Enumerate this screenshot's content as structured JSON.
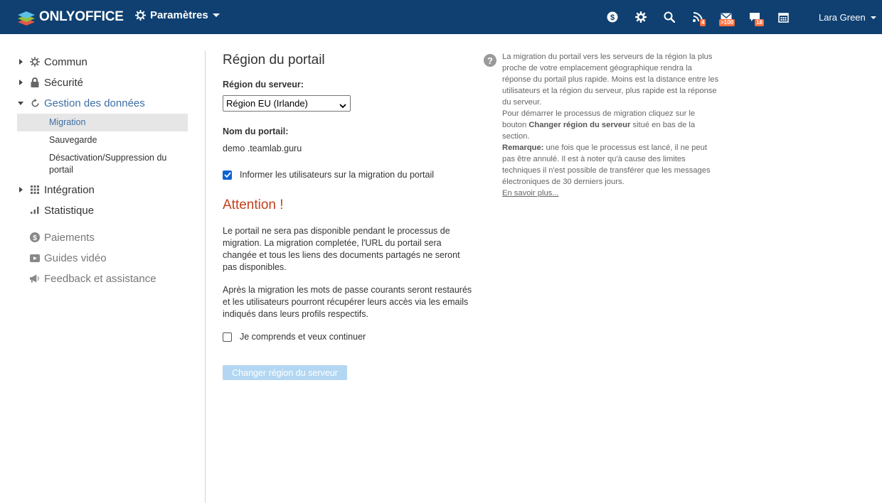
{
  "header": {
    "logo_text": "ONLYOFFICE",
    "settings_label": "Paramètres",
    "icons": [
      {
        "name": "payments-icon",
        "badge": ""
      },
      {
        "name": "gear-icon",
        "badge": ""
      },
      {
        "name": "search-icon",
        "badge": ""
      },
      {
        "name": "feed-icon",
        "badge": "4"
      },
      {
        "name": "mail-icon",
        "badge": ">100"
      },
      {
        "name": "chat-icon",
        "badge": "18"
      },
      {
        "name": "calendar-icon",
        "badge": ""
      }
    ],
    "user_name": "Lara Green",
    "colors": {
      "header_bg": "#0f4071",
      "badge": "#ff6f3d"
    }
  },
  "sidebar": {
    "items": [
      {
        "label": "Commun",
        "icon": "gear-icon"
      },
      {
        "label": "Sécurité",
        "icon": "lock-icon"
      },
      {
        "label": "Gestion des données",
        "icon": "refresh-icon"
      },
      {
        "label": "Intégration",
        "icon": "grid-icon"
      },
      {
        "label": "Statistique",
        "icon": "bar-chart-icon"
      }
    ],
    "sub_items": [
      "Migration",
      "Sauvegarde",
      "Désactivation/Suppression du portail"
    ],
    "extra_items": [
      {
        "label": "Paiements",
        "icon": "dollar-icon"
      },
      {
        "label": "Guides vidéo",
        "icon": "video-icon"
      },
      {
        "label": "Feedback et assistance",
        "icon": "megaphone-icon"
      }
    ]
  },
  "main": {
    "title": "Région du portail",
    "server_region_label": "Région du serveur:",
    "server_region_value": "Région EU (Irlande)",
    "portal_name_label": "Nom du portail:",
    "portal_name_value": "demo .teamlab.guru",
    "notify_label": "Informer les utilisateurs sur la migration du portail",
    "notify_checked": true,
    "attention_title": "Attention !",
    "paragraph_1": "Le portail ne sera pas disponible pendant le processus de migration. La migration completée, l'URL du portail sera changée et tous les liens des documents partagés ne seront pas disponibles.",
    "paragraph_2": "Après la migration les mots de passe courants seront restaurés et les utilisateurs pourront récupérer leurs accès via les emails indiqués dans leurs profils respectifs.",
    "agree_label": "Je comprends et veux continuer",
    "agree_checked": false,
    "change_button": "Changer région du serveur",
    "colors": {
      "attention": "#c3401e",
      "button_disabled": "#b3d7f2",
      "link": "#3e6fa5"
    }
  },
  "help": {
    "text_1": "La migration du portail vers les serveurs de la région la plus proche de votre emplacement géographique rendra la réponse du portail plus rapide. Moins est la distance entre les utilisateurs et la région du serveur, plus rapide est la réponse du serveur.",
    "text_2a": "Pour démarrer le processus de migration cliquez sur le bouton ",
    "text_2b": "Changer région du serveur",
    "text_2c": " situé en bas de la section.",
    "text_3a": "Remarque:",
    "text_3b": " une fois que le processus est lancé, il ne peut pas être annulé. Il est à noter qu'à cause des limites techniques il n'est possible de transférer que les messages électroniques de 30 derniers jours.",
    "link": "En savoir plus..."
  }
}
